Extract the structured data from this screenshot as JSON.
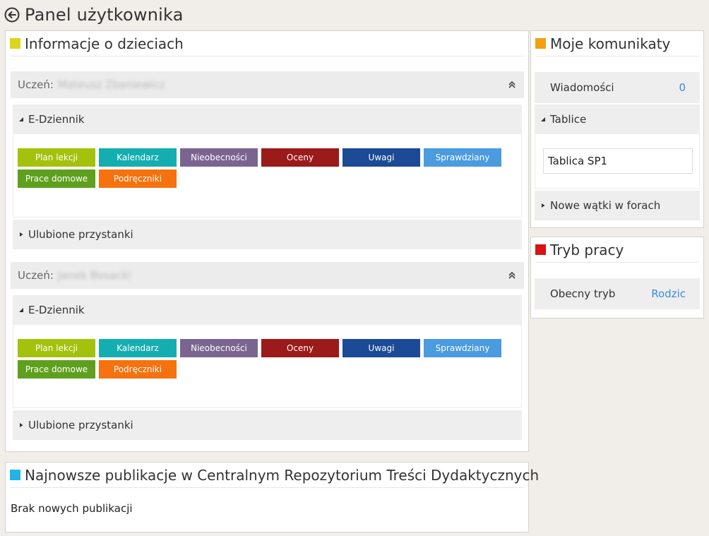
{
  "header": {
    "title": "Panel użytkownika",
    "back_icon": "back-arrow-circle-icon"
  },
  "kids_panel": {
    "title": "Informacje o dzieciach",
    "accent": "#dcd519",
    "students": [
      {
        "label": "Uczeń:",
        "name": "Mateusz Zbaniewicz",
        "ediary": {
          "title": "E-Dziennik",
          "tiles": [
            {
              "label": "Plan lekcji",
              "color": "#a4c20b"
            },
            {
              "label": "Kalendarz",
              "color": "#14aeb0"
            },
            {
              "label": "Nieobecności",
              "color": "#7a6591"
            },
            {
              "label": "Oceny",
              "color": "#9b1a1a"
            },
            {
              "label": "Uwagi",
              "color": "#1b4a96"
            },
            {
              "label": "Sprawdziany",
              "color": "#4a9be0"
            },
            {
              "label": "Prace domowe",
              "color": "#5ea01d"
            },
            {
              "label": "Podręczniki",
              "color": "#f5720e"
            }
          ]
        },
        "favorites": {
          "title": "Ulubione przystanki"
        }
      },
      {
        "label": "Uczeń:",
        "name": "Janek Bosacki",
        "ediary": {
          "title": "E-Dziennik",
          "tiles": [
            {
              "label": "Plan lekcji",
              "color": "#a4c20b"
            },
            {
              "label": "Kalendarz",
              "color": "#14aeb0"
            },
            {
              "label": "Nieobecności",
              "color": "#7a6591"
            },
            {
              "label": "Oceny",
              "color": "#9b1a1a"
            },
            {
              "label": "Uwagi",
              "color": "#1b4a96"
            },
            {
              "label": "Sprawdziany",
              "color": "#4a9be0"
            },
            {
              "label": "Prace domowe",
              "color": "#5ea01d"
            },
            {
              "label": "Podręczniki",
              "color": "#f5720e"
            }
          ]
        },
        "favorites": {
          "title": "Ulubione przystanki"
        }
      }
    ]
  },
  "publications_panel": {
    "title": "Najnowsze publikacje w Centralnym Repozytorium Treści Dydaktycznych",
    "accent": "#23b3e6",
    "empty_text": "Brak nowych publikacji"
  },
  "messages_panel": {
    "title": "Moje komunikaty",
    "accent": "#f2a20e",
    "messages_label": "Wiadomości",
    "messages_count": "0",
    "boards_title": "Tablice",
    "board_item": "Tablica SP1",
    "forums_title": "Nowe wątki w forach"
  },
  "mode_panel": {
    "title": "Tryb pracy",
    "accent": "#d61414",
    "current_label": "Obecny tryb",
    "current_value": "Rodzic"
  }
}
